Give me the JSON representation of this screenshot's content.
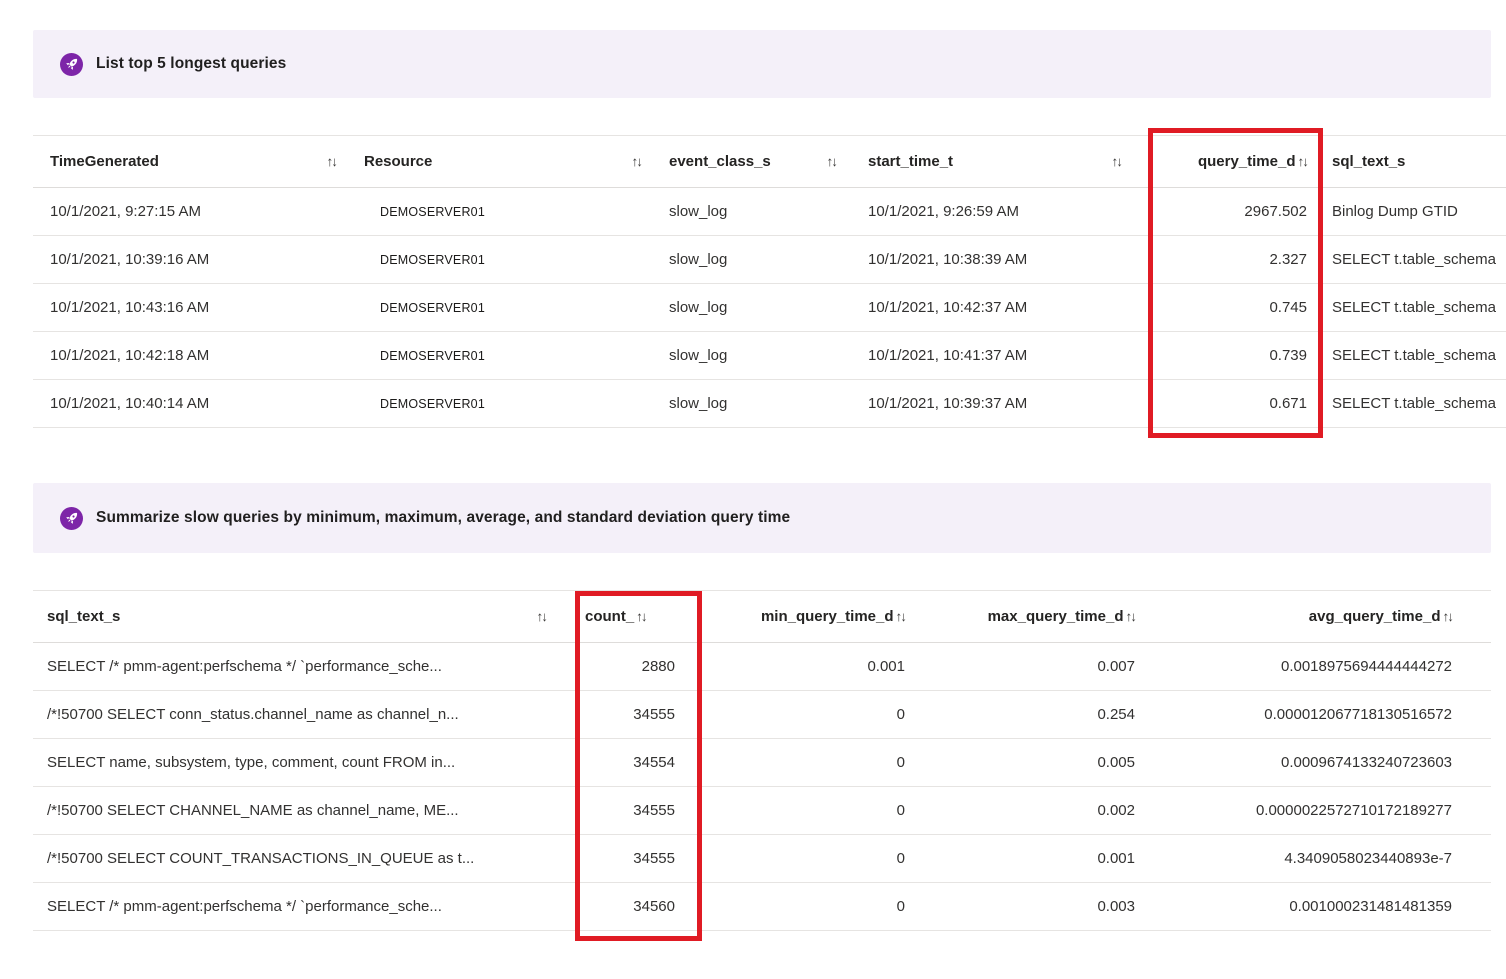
{
  "colors": {
    "banner_bg": "#f4f0f9",
    "accent_purple": "#7d25a8",
    "highlight_red": "#e01b24"
  },
  "icons": {
    "sort": "↑↓"
  },
  "prompt_top": {
    "text": "List top 5 longest queries"
  },
  "prompt_bottom": {
    "text": "Summarize slow queries by minimum, maximum, average, and standard deviation query time"
  },
  "top_table": {
    "headers": {
      "time_generated": "TimeGenerated",
      "resource": "Resource",
      "event_class": "event_class_s",
      "start_time": "start_time_t",
      "query_time": "query_time_d",
      "sql_text": "sql_text_s"
    },
    "highlighted_column": "query_time_d",
    "rows": [
      {
        "time_generated": "10/1/2021, 9:27:15 AM",
        "resource": "DEMOSERVER01",
        "event_class": "slow_log",
        "start_time": "10/1/2021, 9:26:59 AM",
        "query_time": "2967.502",
        "sql_text": "Binlog Dump GTID"
      },
      {
        "time_generated": "10/1/2021, 10:39:16 AM",
        "resource": "DEMOSERVER01",
        "event_class": "slow_log",
        "start_time": "10/1/2021, 10:38:39 AM",
        "query_time": "2.327",
        "sql_text": "SELECT t.table_schema"
      },
      {
        "time_generated": "10/1/2021, 10:43:16 AM",
        "resource": "DEMOSERVER01",
        "event_class": "slow_log",
        "start_time": "10/1/2021, 10:42:37 AM",
        "query_time": "0.745",
        "sql_text": "SELECT t.table_schema"
      },
      {
        "time_generated": "10/1/2021, 10:42:18 AM",
        "resource": "DEMOSERVER01",
        "event_class": "slow_log",
        "start_time": "10/1/2021, 10:41:37 AM",
        "query_time": "0.739",
        "sql_text": "SELECT t.table_schema"
      },
      {
        "time_generated": "10/1/2021, 10:40:14 AM",
        "resource": "DEMOSERVER01",
        "event_class": "slow_log",
        "start_time": "10/1/2021, 10:39:37 AM",
        "query_time": "0.671",
        "sql_text": "SELECT t.table_schema"
      }
    ]
  },
  "bottom_table": {
    "headers": {
      "sql_text": "sql_text_s",
      "count": "count_",
      "min": "min_query_time_d",
      "max": "max_query_time_d",
      "avg": "avg_query_time_d"
    },
    "highlighted_column": "count_",
    "rows": [
      {
        "sql_text": "SELECT /* pmm-agent:perfschema */ `performance_sche...",
        "count": "2880",
        "min": "0.001",
        "max": "0.007",
        "avg": "0.0018975694444444272"
      },
      {
        "sql_text": "/*!50700 SELECT conn_status.channel_name as channel_n...",
        "count": "34555",
        "min": "0",
        "max": "0.254",
        "avg": "0.000012067718130516572"
      },
      {
        "sql_text": "SELECT name, subsystem, type, comment, count FROM in...",
        "count": "34554",
        "min": "0",
        "max": "0.005",
        "avg": "0.0009674133240723603"
      },
      {
        "sql_text": "/*!50700 SELECT CHANNEL_NAME as channel_name, ME...",
        "count": "34555",
        "min": "0",
        "max": "0.002",
        "avg": "0.0000022572710172189277"
      },
      {
        "sql_text": "/*!50700 SELECT COUNT_TRANSACTIONS_IN_QUEUE as t...",
        "count": "34555",
        "min": "0",
        "max": "0.001",
        "avg": "4.3409058023440893e-7"
      },
      {
        "sql_text": "SELECT /* pmm-agent:perfschema */ `performance_sche...",
        "count": "34560",
        "min": "0",
        "max": "0.003",
        "avg": "0.001000231481481359"
      }
    ]
  }
}
